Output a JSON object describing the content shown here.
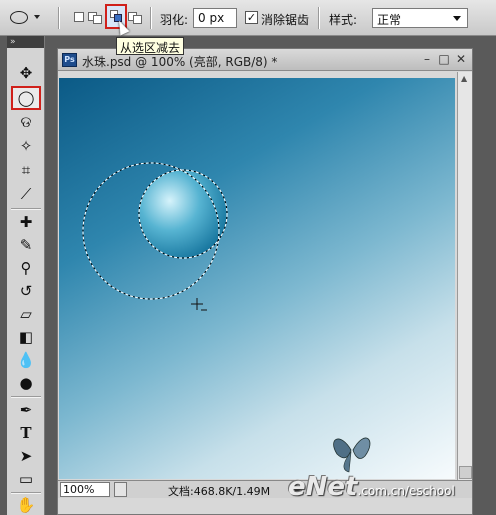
{
  "options": {
    "feather_label": "羽化:",
    "feather_value": "0 px",
    "antialias_label": "消除锯齿",
    "antialias_checked": "✓",
    "style_label": "样式:",
    "style_value": "正常",
    "tooltip": "从选区减去"
  },
  "document": {
    "title": "水珠.psd @ 100% (亮部, RGB/8) *",
    "badge": "Ps",
    "zoom": "100%",
    "doc_info": "文档:468.8K/1.49M"
  },
  "watermark": {
    "logo": "eNet",
    "url": ".com.cn/eschool"
  },
  "colors": {
    "accent_red": "#d0201a",
    "canvas_dark": "#0b5a86",
    "canvas_light": "#f7fbfd"
  }
}
